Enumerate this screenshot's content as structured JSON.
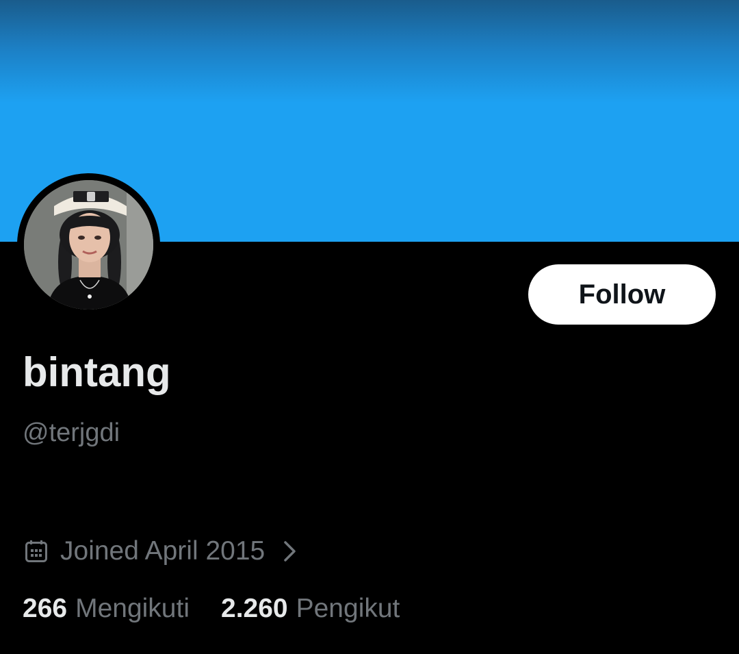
{
  "colors": {
    "banner": "#1da1f2",
    "background": "#000000",
    "primary_text": "#e7e9ea",
    "secondary_text": "#71767b",
    "follow_button_bg": "#ffffff",
    "follow_button_text": "#0f1419"
  },
  "profile": {
    "display_name": "bintang",
    "handle": "@terjgdi",
    "follow_label": "Follow",
    "joined": {
      "icon": "calendar-icon",
      "text": "Joined April 2015",
      "chevron_icon": "chevron-right-icon"
    },
    "stats": {
      "following_count": "266",
      "following_label": "Mengikuti",
      "followers_count": "2.260",
      "followers_label": "Pengikut"
    }
  }
}
